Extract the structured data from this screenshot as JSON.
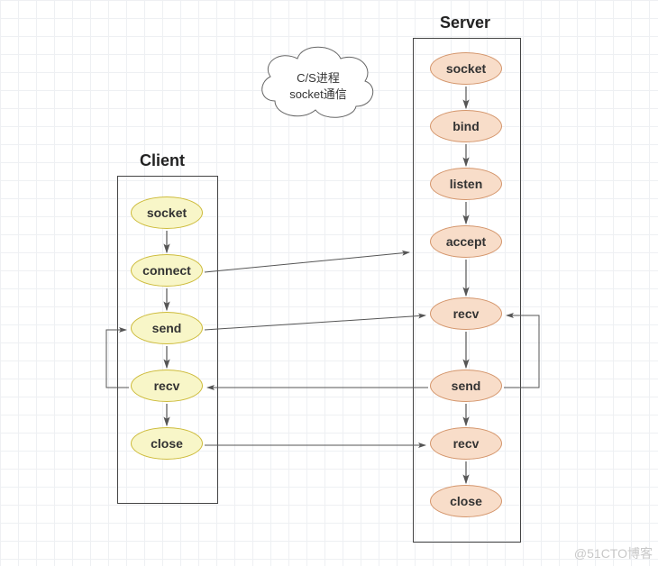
{
  "titles": {
    "client": "Client",
    "server": "Server"
  },
  "cloud": {
    "line1": "C/S进程",
    "line2": "socket通信"
  },
  "client_nodes": {
    "socket": {
      "label": "socket"
    },
    "connect": {
      "label": "connect"
    },
    "send": {
      "label": "send"
    },
    "recv": {
      "label": "recv"
    },
    "close": {
      "label": "close"
    }
  },
  "server_nodes": {
    "socket": {
      "label": "socket"
    },
    "bind": {
      "label": "bind"
    },
    "listen": {
      "label": "listen"
    },
    "accept": {
      "label": "accept"
    },
    "recv1": {
      "label": "recv"
    },
    "send": {
      "label": "send"
    },
    "recv2": {
      "label": "recv"
    },
    "close": {
      "label": "close"
    }
  },
  "watermark": "@51CTO博客",
  "chart_data": {
    "type": "diagram",
    "title": "C/S进程 socket通信",
    "columns": [
      {
        "name": "Client",
        "steps": [
          "socket",
          "connect",
          "send",
          "recv",
          "close"
        ]
      },
      {
        "name": "Server",
        "steps": [
          "socket",
          "bind",
          "listen",
          "accept",
          "recv",
          "send",
          "recv",
          "close"
        ]
      }
    ],
    "vertical_edges": {
      "Client": [
        [
          "socket",
          "connect"
        ],
        [
          "connect",
          "send"
        ],
        [
          "send",
          "recv"
        ],
        [
          "recv",
          "close"
        ]
      ],
      "Server": [
        [
          "socket",
          "bind"
        ],
        [
          "bind",
          "listen"
        ],
        [
          "listen",
          "accept"
        ],
        [
          "accept",
          "recv"
        ],
        [
          "recv",
          "send"
        ],
        [
          "send",
          "recv"
        ],
        [
          "recv",
          "close"
        ]
      ]
    },
    "cross_edges": [
      {
        "from": "Client.connect",
        "to": "Server.accept"
      },
      {
        "from": "Client.send",
        "to": "Server.recv"
      },
      {
        "from": "Server.send",
        "to": "Client.recv"
      },
      {
        "from": "Client.close",
        "to": "Server.recv"
      }
    ],
    "loop_edges": [
      {
        "around": "Client",
        "from": "recv",
        "to": "send"
      },
      {
        "around": "Server",
        "from": "send",
        "to": "recv"
      }
    ]
  }
}
